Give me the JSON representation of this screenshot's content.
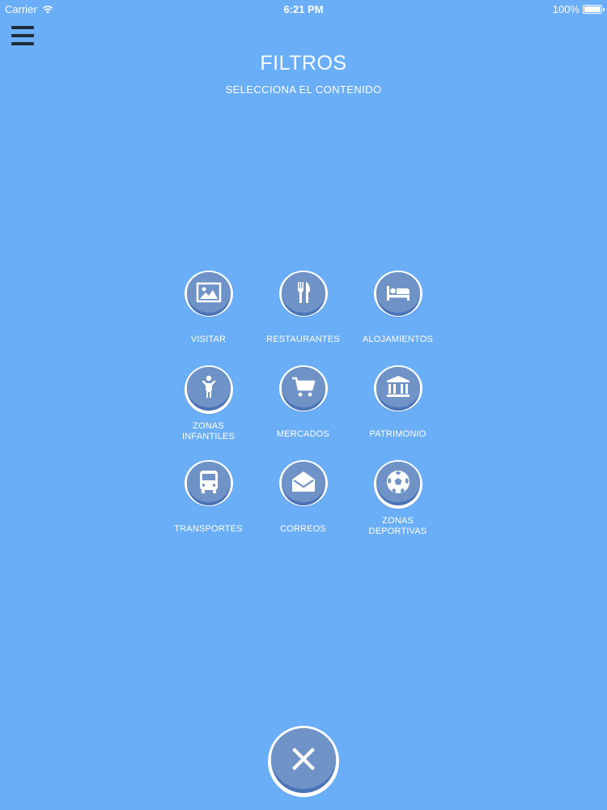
{
  "status_bar": {
    "carrier": "Carrier",
    "time": "6:21 PM",
    "battery": "100%"
  },
  "header": {
    "title": "FILTROS",
    "subtitle": "SELECCIONA EL CONTENIDO"
  },
  "filters": [
    {
      "label": "VISITAR",
      "icon": "image-icon"
    },
    {
      "label": "RESTAURANTES",
      "icon": "fork-knife-icon"
    },
    {
      "label": "ALOJAMIENTOS",
      "icon": "bed-icon"
    },
    {
      "label": "ZONAS\nINFANTILES",
      "icon": "child-icon"
    },
    {
      "label": "MERCADOS",
      "icon": "cart-icon"
    },
    {
      "label": "PATRIMONIO",
      "icon": "museum-icon"
    },
    {
      "label": "TRANSPORTES",
      "icon": "bus-icon"
    },
    {
      "label": "CORREOS",
      "icon": "mail-icon"
    },
    {
      "label": "ZONAS\nDEPORTIVAS",
      "icon": "soccer-ball-icon"
    }
  ],
  "colors": {
    "background": "#6aaef7",
    "button_face": "#6f93c6",
    "button_shadow": "#4b73b8",
    "icon": "#ffffff"
  }
}
